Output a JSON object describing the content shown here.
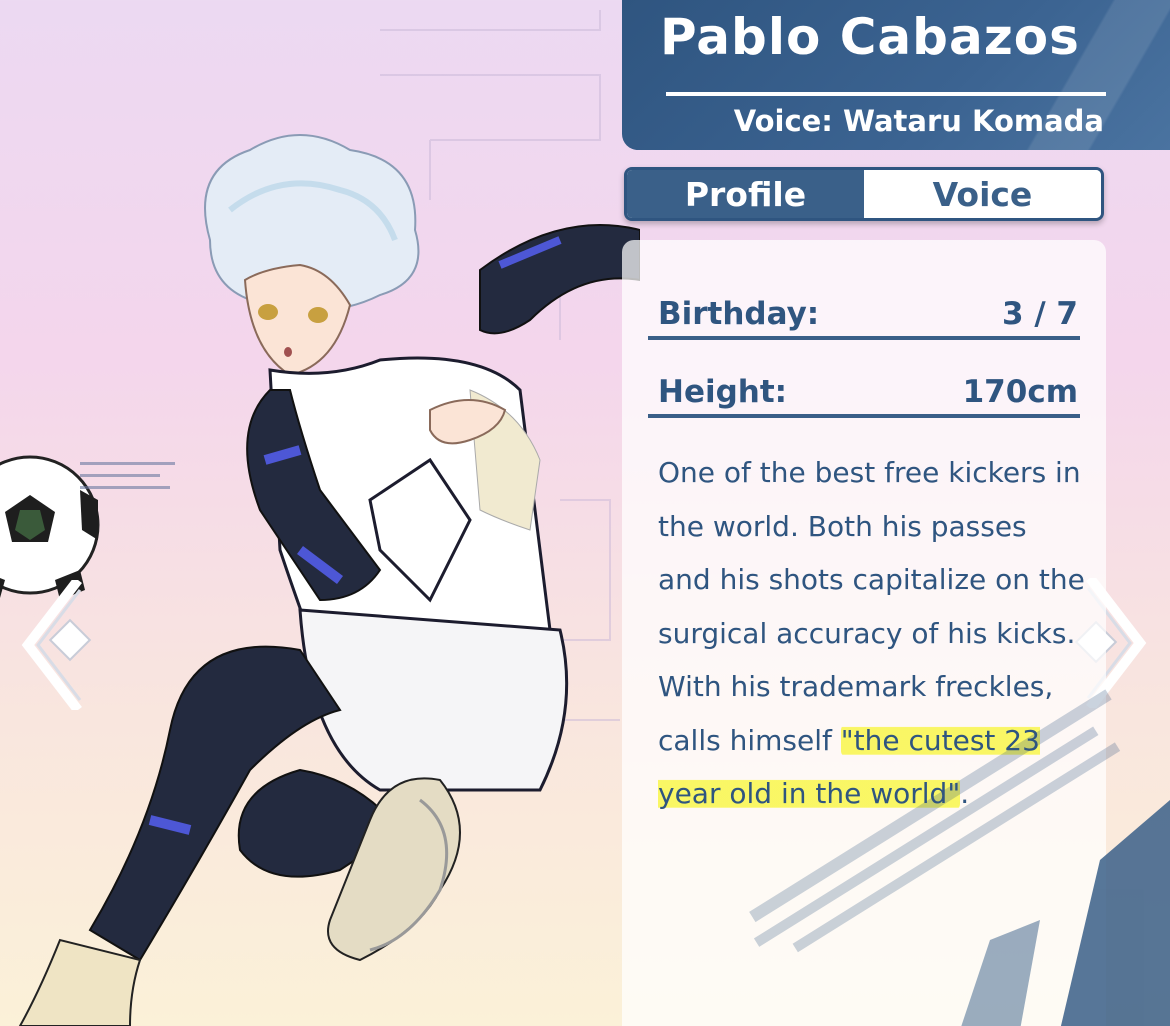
{
  "profile": {
    "name": "Pablo Cabazos",
    "voice_credit": "Voice: Wataru Komada",
    "tabs": [
      {
        "label": "Profile",
        "active": true
      },
      {
        "label": "Voice",
        "active": false
      }
    ],
    "fields": [
      {
        "label": "Birthday:",
        "value": "3 / 7"
      },
      {
        "label": "Height:",
        "value": "170cm"
      }
    ],
    "description_plain": "One of the best free kickers in the world. Both his passes and his shots capitalize on the surgical accuracy of his kicks. With his trademark freckles, calls himself ",
    "description_highlight": "\"the cutest 23 year old in the world\"",
    "description_end": "."
  },
  "colors": {
    "primary": "#2f5580",
    "tab_active": "#3a6089",
    "highlight": "#f8f63c",
    "background_top": "#ecd9f2",
    "background_bottom": "#fbf1d8"
  },
  "icons": {
    "left": "chevron-left-icon",
    "right": "chevron-right-icon",
    "ball": "soccer-ball-icon"
  }
}
